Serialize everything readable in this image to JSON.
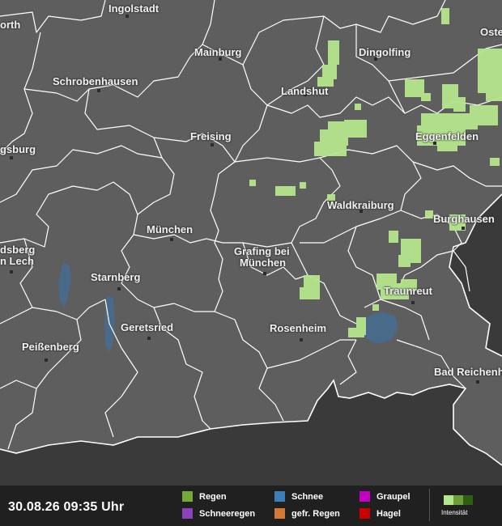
{
  "map": {
    "cities": [
      {
        "name": "Ingolstadt"
      },
      {
        "name": "orth"
      },
      {
        "name": "Oste"
      },
      {
        "name": "Mainburg"
      },
      {
        "name": "Dingolfing"
      },
      {
        "name": "Schrobenhausen"
      },
      {
        "name": "Landshut"
      },
      {
        "name": "Freising"
      },
      {
        "name": "Eggenfelden"
      },
      {
        "name": "gsburg"
      },
      {
        "name": "Waldkraiburg"
      },
      {
        "name": "Burghausen"
      },
      {
        "name": "München"
      },
      {
        "name": "dsberg"
      },
      {
        "name": "n Lech"
      },
      {
        "name": "Grafing bei"
      },
      {
        "name": "München"
      },
      {
        "name": "Starnberg"
      },
      {
        "name": "Traunreut"
      },
      {
        "name": "Geretsried"
      },
      {
        "name": "Rosenheim"
      },
      {
        "name": "Peißenberg"
      },
      {
        "name": "Bad Reichenh"
      }
    ]
  },
  "footer": {
    "timestamp": "30.08.26 09:35 Uhr",
    "legend": [
      {
        "label": "Regen",
        "color": "#77a83a"
      },
      {
        "label": "Schneeregen",
        "color": "#8a44b8"
      },
      {
        "label": "Schnee",
        "color": "#3b7fb8"
      },
      {
        "label": "gefr. Regen",
        "color": "#d07a33"
      },
      {
        "label": "Graupel",
        "color": "#c400c4"
      },
      {
        "label": "Hagel",
        "color": "#cc0000"
      }
    ],
    "intensity_label": "Intensität",
    "intensity_colors": [
      "#b6e68c",
      "#6d9e3c",
      "#2f5e12"
    ]
  },
  "colors": {
    "land": "#5e5e5e",
    "outside_region": "#3a3a3a",
    "borders": "#ffffff",
    "water": "#4a6a8a",
    "rain_light": "#b6e68c"
  }
}
